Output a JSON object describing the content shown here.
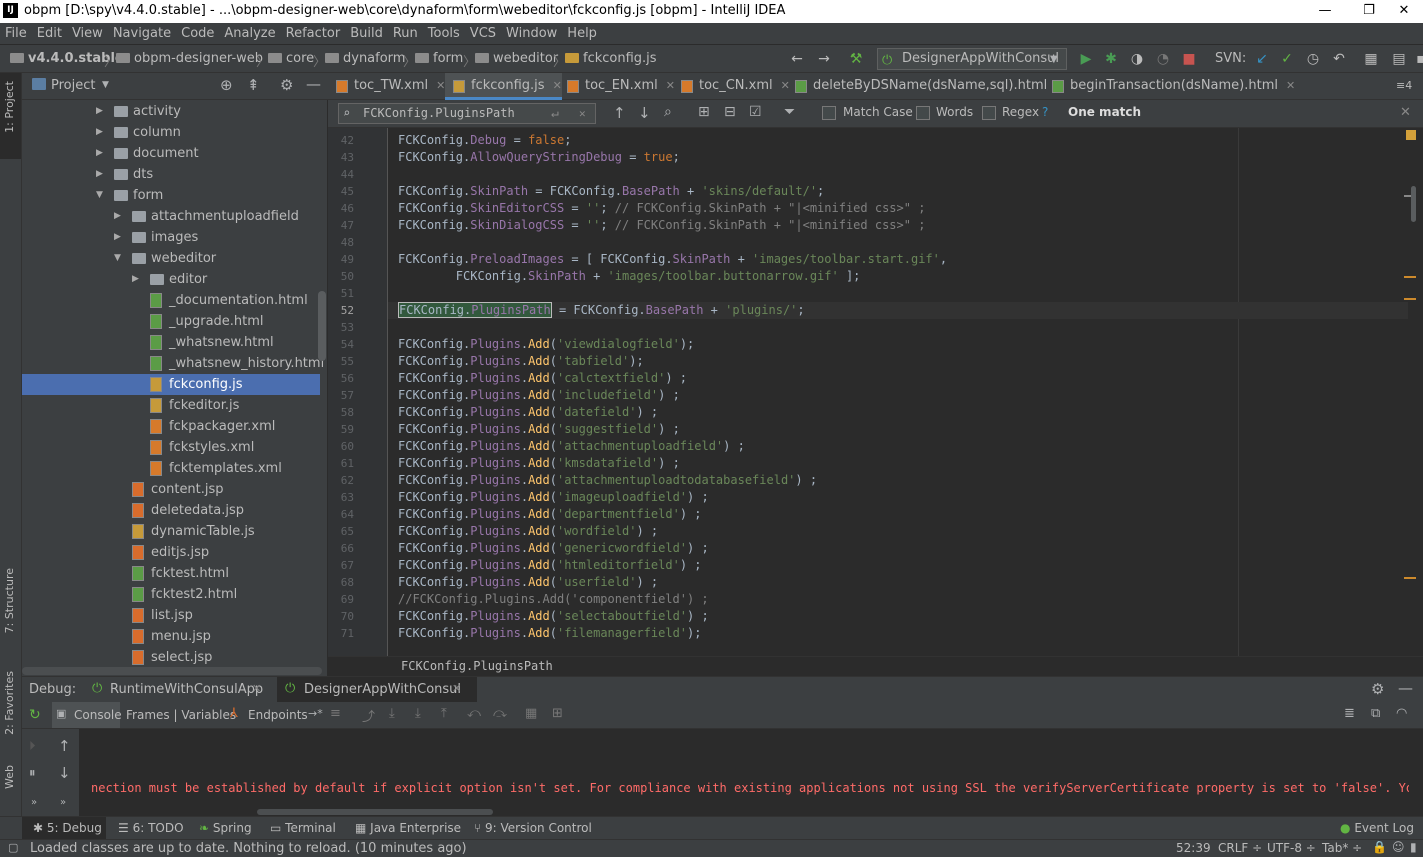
{
  "window": {
    "title": "obpm [D:\\spy\\v4.4.0.stable] - ...\\obpm-designer-web\\core\\dynaform\\form\\webeditor\\fckconfig.js [obpm] - IntelliJ IDEA",
    "logo": "IJ"
  },
  "menu": [
    "File",
    "Edit",
    "View",
    "Navigate",
    "Code",
    "Analyze",
    "Refactor",
    "Build",
    "Run",
    "Tools",
    "VCS",
    "Window",
    "Help"
  ],
  "breadcrumb": [
    "v4.4.0.stable",
    "obpm-designer-web",
    "core",
    "dynaform",
    "form",
    "webeditor",
    "fckconfig.js"
  ],
  "run_config": "DesignerAppWithConsul",
  "svn_label": "SVN:",
  "left_strip": {
    "project": "1: Project",
    "structure": "7: Structure",
    "favorites": "2: Favorites",
    "web": "Web"
  },
  "project": {
    "title": "Project",
    "tree": [
      {
        "label": "activity",
        "type": "folder",
        "level": 0
      },
      {
        "label": "column",
        "type": "folder",
        "level": 0
      },
      {
        "label": "document",
        "type": "folder",
        "level": 0
      },
      {
        "label": "dts",
        "type": "folder",
        "level": 0
      },
      {
        "label": "form",
        "type": "folder",
        "level": 0,
        "open": true
      },
      {
        "label": "attachmentuploadfield",
        "type": "folder",
        "level": 1
      },
      {
        "label": "images",
        "type": "folder",
        "level": 1
      },
      {
        "label": "webeditor",
        "type": "folder",
        "level": 1,
        "open": true
      },
      {
        "label": "editor",
        "type": "folder",
        "level": 2
      },
      {
        "label": "_documentation.html",
        "type": "html",
        "level": 2
      },
      {
        "label": "_upgrade.html",
        "type": "html",
        "level": 2
      },
      {
        "label": "_whatsnew.html",
        "type": "html",
        "level": 2
      },
      {
        "label": "_whatsnew_history.html",
        "type": "html",
        "level": 2
      },
      {
        "label": "fckconfig.js",
        "type": "js",
        "level": 2,
        "selected": true
      },
      {
        "label": "fckeditor.js",
        "type": "js",
        "level": 2
      },
      {
        "label": "fckpackager.xml",
        "type": "xml",
        "level": 2
      },
      {
        "label": "fckstyles.xml",
        "type": "xml",
        "level": 2
      },
      {
        "label": "fcktemplates.xml",
        "type": "xml",
        "level": 2
      },
      {
        "label": "content.jsp",
        "type": "jsp",
        "level": 1
      },
      {
        "label": "deletedata.jsp",
        "type": "jsp",
        "level": 1
      },
      {
        "label": "dynamicTable.js",
        "type": "js",
        "level": 1
      },
      {
        "label": "editjs.jsp",
        "type": "jsp",
        "level": 1
      },
      {
        "label": "fcktest.html",
        "type": "html",
        "level": 1
      },
      {
        "label": "fcktest2.html",
        "type": "html",
        "level": 1
      },
      {
        "label": "list.jsp",
        "type": "jsp",
        "level": 1
      },
      {
        "label": "menu.jsp",
        "type": "jsp",
        "level": 1
      },
      {
        "label": "select.jsp",
        "type": "jsp",
        "level": 1
      }
    ]
  },
  "tabs": [
    {
      "label": "toc_TW.xml",
      "type": "x"
    },
    {
      "label": "fckconfig.js",
      "type": "js",
      "active": true
    },
    {
      "label": "toc_EN.xml",
      "type": "x"
    },
    {
      "label": "toc_CN.xml",
      "type": "x"
    },
    {
      "label": "deleteByDSName(dsName,sql).html",
      "type": "h"
    },
    {
      "label": "beginTransaction(dsName).html",
      "type": "h"
    }
  ],
  "tab_overflow": "≡4",
  "find": {
    "value": "FCKConfig.PluginsPath",
    "match_case": "Match Case",
    "words": "Words",
    "regex": "Regex",
    "help": "?",
    "result": "One match"
  },
  "code": {
    "lines": [
      {
        "n": "42",
        "html": "FCKConfig.<span class='pr'>Debug</span> = <span class='kw'>false</span>;"
      },
      {
        "n": "43",
        "html": "FCKConfig.<span class='pr'>AllowQueryStringDebug</span> = <span class='kw'>true</span>;"
      },
      {
        "n": "44",
        "html": ""
      },
      {
        "n": "45",
        "html": "FCKConfig.<span class='pr'>SkinPath</span> = FCKConfig.<span class='pr'>BasePath</span> + <span class='st'>'skins/default/'</span>;"
      },
      {
        "n": "46",
        "html": "FCKConfig.<span class='pr'>SkinEditorCSS</span> = <span class='st'>''</span>; <span class='cm'>// FCKConfig.SkinPath + \"|&lt;minified css&gt;\" ;</span>"
      },
      {
        "n": "47",
        "html": "FCKConfig.<span class='pr'>SkinDialogCSS</span> = <span class='st'>''</span>; <span class='cm'>// FCKConfig.SkinPath + \"|&lt;minified css&gt;\" ;</span>"
      },
      {
        "n": "48",
        "html": ""
      },
      {
        "n": "49",
        "html": "FCKConfig.<span class='pr'>PreloadImages</span> = [ FCKConfig.<span class='pr'>SkinPath</span> + <span class='st'>'images/toolbar.start.gif'</span>,"
      },
      {
        "n": "50",
        "html": "        FCKConfig.<span class='pr'>SkinPath</span> + <span class='st'>'images/toolbar.buttonarrow.gif'</span> ];"
      },
      {
        "n": "51",
        "html": ""
      },
      {
        "n": "52",
        "html": "<span class='hl'>FCKConfig.<span class='pr'>PluginsPath</span></span> = FCKConfig.<span class='pr'>BasePath</span> + <span class='st'>'plugins/'</span>;",
        "cur": true
      },
      {
        "n": "53",
        "html": ""
      },
      {
        "n": "54",
        "html": "FCKConfig.<span class='pr'>Plugins</span>.<span class='fn'>Add</span>(<span class='st'>'viewdialogfield'</span>);"
      },
      {
        "n": "55",
        "html": "FCKConfig.<span class='pr'>Plugins</span>.<span class='fn'>Add</span>(<span class='st'>'tabfield'</span>);"
      },
      {
        "n": "56",
        "html": "FCKConfig.<span class='pr'>Plugins</span>.<span class='fn'>Add</span>(<span class='st'>'calctextfield'</span>) ;"
      },
      {
        "n": "57",
        "html": "FCKConfig.<span class='pr'>Plugins</span>.<span class='fn'>Add</span>(<span class='st'>'includefield'</span>) ;"
      },
      {
        "n": "58",
        "html": "FCKConfig.<span class='pr'>Plugins</span>.<span class='fn'>Add</span>(<span class='st'>'datefield'</span>) ;"
      },
      {
        "n": "59",
        "html": "FCKConfig.<span class='pr'>Plugins</span>.<span class='fn'>Add</span>(<span class='st'>'suggestfield'</span>) ;"
      },
      {
        "n": "60",
        "html": "FCKConfig.<span class='pr'>Plugins</span>.<span class='fn'>Add</span>(<span class='st'>'attachmentuploadfield'</span>) ;"
      },
      {
        "n": "61",
        "html": "FCKConfig.<span class='pr'>Plugins</span>.<span class='fn'>Add</span>(<span class='st'>'kmsdatafield'</span>) ;"
      },
      {
        "n": "62",
        "html": "FCKConfig.<span class='pr'>Plugins</span>.<span class='fn'>Add</span>(<span class='st'>'attachmentuploadtodatabasefield'</span>) ;"
      },
      {
        "n": "63",
        "html": "FCKConfig.<span class='pr'>Plugins</span>.<span class='fn'>Add</span>(<span class='st'>'imageuploadfield'</span>) ;"
      },
      {
        "n": "64",
        "html": "FCKConfig.<span class='pr'>Plugins</span>.<span class='fn'>Add</span>(<span class='st'>'departmentfield'</span>) ;"
      },
      {
        "n": "65",
        "html": "FCKConfig.<span class='pr'>Plugins</span>.<span class='fn'>Add</span>(<span class='st'>'wordfield'</span>) ;"
      },
      {
        "n": "66",
        "html": "FCKConfig.<span class='pr'>Plugins</span>.<span class='fn'>Add</span>(<span class='st'>'genericwordfield'</span>) ;"
      },
      {
        "n": "67",
        "html": "FCKConfig.<span class='pr'>Plugins</span>.<span class='fn'>Add</span>(<span class='st'>'htmleditorfield'</span>) ;"
      },
      {
        "n": "68",
        "html": "FCKConfig.<span class='pr'>Plugins</span>.<span class='fn'>Add</span>(<span class='st'>'userfield'</span>) ;"
      },
      {
        "n": "69",
        "html": "<span class='cm'>//FCKConfig.Plugins.Add('componentfield') ;</span>"
      },
      {
        "n": "70",
        "html": "FCKConfig.<span class='pr'>Plugins</span>.<span class='fn'>Add</span>(<span class='st'>'selectaboutfield'</span>) ;"
      },
      {
        "n": "71",
        "html": "FCKConfig.<span class='pr'>Plugins</span>.<span class='fn'>Add</span>(<span class='st'>'filemanagerfield'</span>);"
      }
    ],
    "footer_crumb": "FCKConfig.PluginsPath"
  },
  "debug": {
    "label": "Debug:",
    "sessions": [
      "RuntimeWithConsulApp",
      "DesignerAppWithConsul"
    ],
    "tabs": [
      "Console",
      "Frames | Variables",
      "Endpoints"
    ],
    "message": "nection must be established by default if explicit option isn't set. For compliance with existing applications not using SSL the verifyServerCertificate property is set to 'false'. You need"
  },
  "bottom_tabs": [
    "5: Debug",
    "6: TODO",
    "Spring",
    "Terminal",
    "Java Enterprise",
    "9: Version Control"
  ],
  "event_log": "Event Log",
  "status": {
    "message": "Loaded classes are up to date. Nothing to reload. (10 minutes ago)",
    "position": "52:39",
    "line_sep": "CRLF ÷",
    "encoding": "UTF-8 ÷",
    "indent": "Tab* ÷"
  }
}
